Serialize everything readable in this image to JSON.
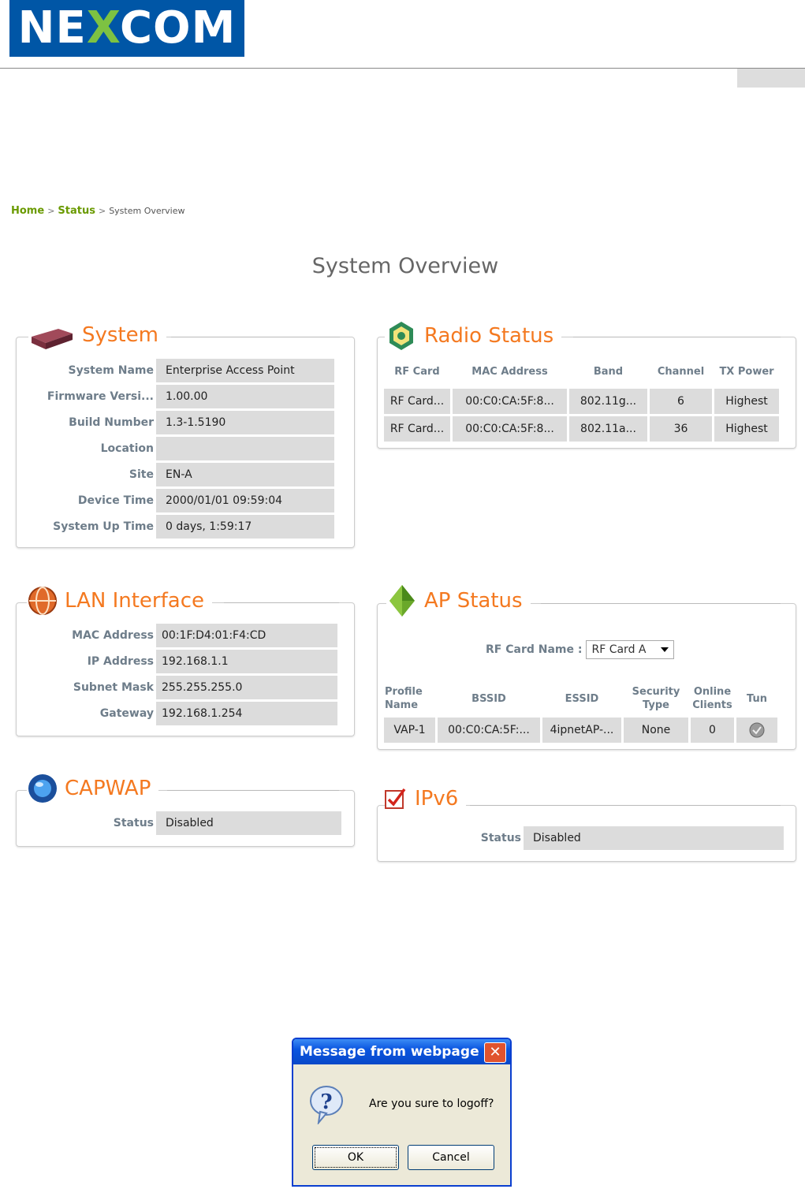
{
  "brand": {
    "logo_text_pre": "NE",
    "logo_text_x": "X",
    "logo_text_post": "COM"
  },
  "breadcrumb": {
    "home": "Home",
    "status": "Status",
    "current": "System Overview",
    "separator": ">"
  },
  "page_title": "System Overview",
  "system": {
    "title": "System",
    "rows": [
      {
        "label": "System Name",
        "value": "Enterprise Access Point"
      },
      {
        "label": "Firmware Versi...",
        "value": "1.00.00"
      },
      {
        "label": "Build Number",
        "value": "1.3-1.5190"
      },
      {
        "label": "Location",
        "value": ""
      },
      {
        "label": "Site",
        "value": "EN-A"
      },
      {
        "label": "Device Time",
        "value": "2000/01/01 09:59:04"
      },
      {
        "label": "System Up Time",
        "value": "0 days, 1:59:17"
      }
    ]
  },
  "radio_status": {
    "title": "Radio Status",
    "headers": [
      "RF Card",
      "MAC Address",
      "Band",
      "Channel",
      "TX Power"
    ],
    "rows": [
      [
        "RF Card...",
        "00:C0:CA:5F:8...",
        "802.11g...",
        "6",
        "Highest"
      ],
      [
        "RF Card...",
        "00:C0:CA:5F:8...",
        "802.11a...",
        "36",
        "Highest"
      ]
    ]
  },
  "lan": {
    "title": "LAN Interface",
    "rows": [
      {
        "label": "MAC Address",
        "value": "00:1F:D4:01:F4:CD"
      },
      {
        "label": "IP Address",
        "value": "192.168.1.1"
      },
      {
        "label": "Subnet Mask",
        "value": "255.255.255.0"
      },
      {
        "label": "Gateway",
        "value": "192.168.1.254"
      }
    ]
  },
  "ap_status": {
    "title": "AP Status",
    "rf_card_label": "RF Card Name :",
    "rf_card_selected": "RF Card A",
    "headers": [
      "Profile Name",
      "BSSID",
      "ESSID",
      "Security Type",
      "Online Clients",
      "Tun"
    ],
    "rows": [
      [
        "VAP-1",
        "00:C0:CA:5F:...",
        "4ipnetAP-...",
        "None",
        "0"
      ]
    ]
  },
  "capwap": {
    "title": "CAPWAP",
    "status_label": "Status",
    "status_value": "Disabled"
  },
  "ipv6": {
    "title": "IPv6",
    "status_label": "Status",
    "status_value": "Disabled"
  },
  "dialog": {
    "title": "Message from webpage",
    "message": "Are you sure to logoff?",
    "ok": "OK",
    "cancel": "Cancel",
    "close_glyph": "✕"
  },
  "colors": {
    "accent": "#f47920",
    "label": "#6e7d8a",
    "link": "#6a9a00",
    "field": "#dcdcdc",
    "brand": "#0056a6"
  }
}
